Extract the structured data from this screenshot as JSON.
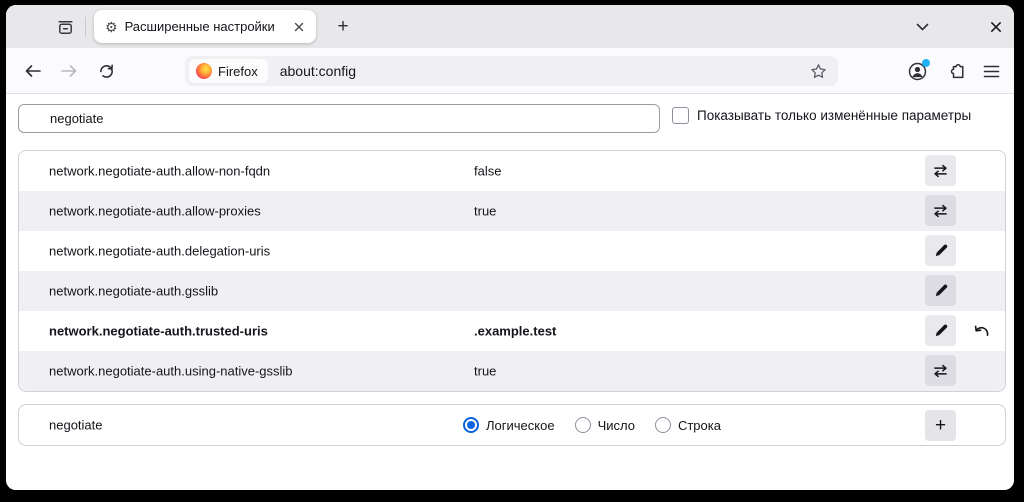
{
  "titlebar": {
    "tab": {
      "title": "Расширенные настройки"
    },
    "new_tab_label": "+"
  },
  "navbar": {
    "identity_label": "Firefox",
    "url": "about:config"
  },
  "glyphs": {
    "gear": "⚙",
    "back_arrow": "←",
    "forward_arrow": "→"
  },
  "search": {
    "value": "negotiate",
    "filter_label": "Показывать только изменённые параметры",
    "filter_checked": false
  },
  "prefs": {
    "rows": [
      {
        "name": "network.negotiate-auth.allow-non-fqdn",
        "value": "false",
        "action": "toggle",
        "modified": false
      },
      {
        "name": "network.negotiate-auth.allow-proxies",
        "value": "true",
        "action": "toggle",
        "modified": false
      },
      {
        "name": "network.negotiate-auth.delegation-uris",
        "value": "",
        "action": "edit",
        "modified": false
      },
      {
        "name": "network.negotiate-auth.gsslib",
        "value": "",
        "action": "edit",
        "modified": false
      },
      {
        "name": "network.negotiate-auth.trusted-uris",
        "value": ".example.test",
        "action": "edit",
        "modified": true
      },
      {
        "name": "network.negotiate-auth.using-native-gsslib",
        "value": "true",
        "action": "toggle",
        "modified": false
      }
    ]
  },
  "add_pref": {
    "name": "negotiate",
    "types": [
      {
        "label": "Логическое",
        "selected": true
      },
      {
        "label": "Число",
        "selected": false
      },
      {
        "label": "Строка",
        "selected": false
      }
    ],
    "add_label": "+"
  },
  "colors": {
    "accent": "#0a63e1",
    "notification_dot": "#20b1f7",
    "row_alt": "#f0f0f4",
    "titlebar_bg": "#e8e7e9"
  }
}
